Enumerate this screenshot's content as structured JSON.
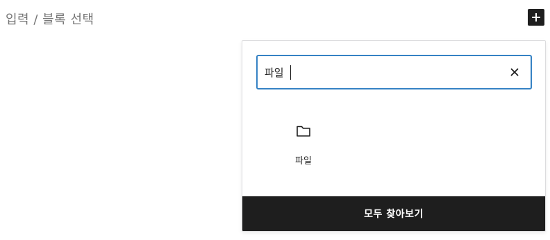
{
  "editor": {
    "placeholder": "입력 / 블록 선택"
  },
  "inserter_toggle": {
    "icon": "plus-icon"
  },
  "inserter": {
    "search_value": "파일",
    "clear_icon": "close-icon",
    "results": [
      {
        "icon": "folder-icon",
        "label": "파일"
      }
    ],
    "browse_all_label": "모두 찾아보기"
  },
  "colors": {
    "focus_border": "#3582c4",
    "dark": "#1e1e1e",
    "placeholder_text": "#757575"
  }
}
